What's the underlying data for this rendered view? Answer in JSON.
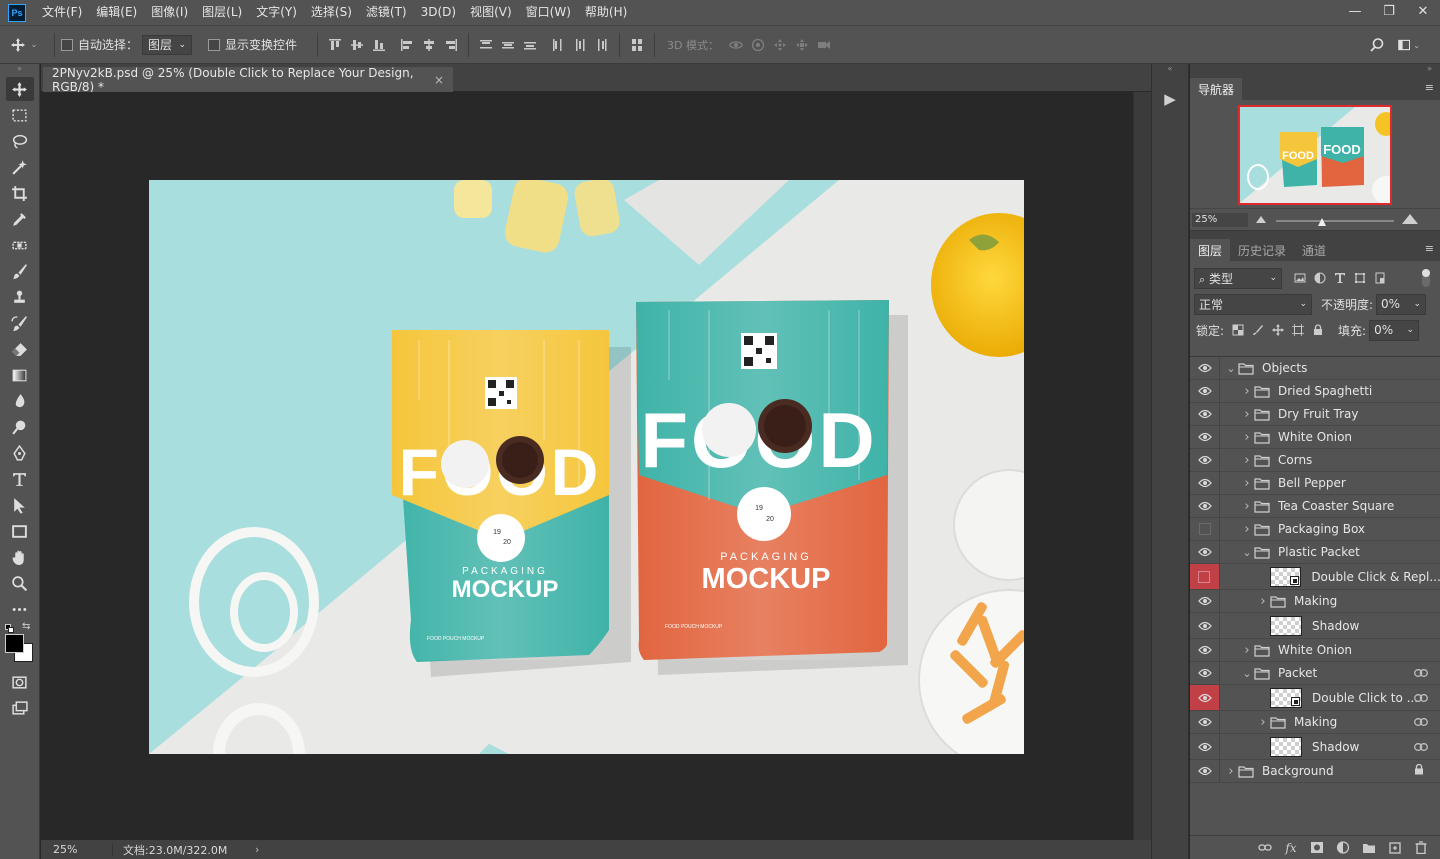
{
  "app": {
    "logo": "Ps"
  },
  "menu": [
    "文件(F)",
    "编辑(E)",
    "图像(I)",
    "图层(L)",
    "文字(Y)",
    "选择(S)",
    "滤镜(T)",
    "3D(D)",
    "视图(V)",
    "窗口(W)",
    "帮助(H)"
  ],
  "window_controls": {
    "minimize": "—",
    "restore": "❐",
    "close": "✕"
  },
  "options": {
    "auto_select_label": "自动选择：",
    "auto_select_value": "图层",
    "show_transform_label": "显示变换控件",
    "mode3d_label": "3D 模式："
  },
  "document": {
    "tab_title": "2PNyv2kB.psd @ 25% (Double Click to Replace Your Design, RGB/8) *",
    "close": "×"
  },
  "status": {
    "zoom": "25%",
    "doc_info": "文档:23.0M/322.0M",
    "arrow": "›"
  },
  "artwork": {
    "yellow_bag": {
      "word": "FOOD",
      "sub": "PACKAGING",
      "title": "MOCKUP",
      "badge_top": "19",
      "badge_bottom": "20",
      "footer": "FOOD POUCH MOCKUP"
    },
    "orange_bag": {
      "word": "FOOD",
      "sub": "PACKAGING",
      "title": "MOCKUP",
      "badge_top": "19",
      "badge_bottom": "20",
      "footer": "FOOD POUCH MOCKUP"
    }
  },
  "colors": {
    "mint": "#a8dedd",
    "paper": "#e9e9e8",
    "yellow": "#f5c63c",
    "teal": "#3fb3a8",
    "orange": "#e2653f",
    "selection_red": "#c04046"
  },
  "navigator": {
    "tab": "导航器",
    "zoom": "25%"
  },
  "layers_panel": {
    "tabs": [
      "图层",
      "历史记录",
      "通道"
    ],
    "filter_kind": "类型",
    "blend_mode": "正常",
    "opacity_label": "不透明度:",
    "opacity_value": "0%",
    "lock_label": "锁定:",
    "fill_label": "填充:",
    "fill_value": "0%",
    "layers": [
      {
        "name": "Objects",
        "type": "group",
        "indent": 0,
        "open": true
      },
      {
        "name": "Dried Spaghetti",
        "type": "group",
        "indent": 1
      },
      {
        "name": "Dry Fruit Tray",
        "type": "group",
        "indent": 1
      },
      {
        "name": "White Onion",
        "type": "group",
        "indent": 1
      },
      {
        "name": "Corns",
        "type": "group",
        "indent": 1
      },
      {
        "name": "Bell Pepper",
        "type": "group",
        "indent": 1
      },
      {
        "name": "Tea Coaster Square",
        "type": "group",
        "indent": 1
      },
      {
        "name": "Packaging Box",
        "type": "group",
        "indent": 1,
        "hidden": true
      },
      {
        "name": "Plastic Packet",
        "type": "group",
        "indent": 1,
        "open": true
      },
      {
        "name": "Double Click & Repl...",
        "type": "smart",
        "indent": 2,
        "hidden": true,
        "red": true
      },
      {
        "name": "Making",
        "type": "group",
        "indent": 2
      },
      {
        "name": "Shadow",
        "type": "pixel",
        "indent": 2
      },
      {
        "name": "White Onion",
        "type": "group",
        "indent": 1
      },
      {
        "name": "Packet",
        "type": "group",
        "indent": 1,
        "open": true,
        "linked": true
      },
      {
        "name": "Double Click to ...",
        "type": "smart",
        "indent": 2,
        "red": true,
        "selected": true,
        "linked": true
      },
      {
        "name": "Making",
        "type": "group",
        "indent": 2,
        "linked": true
      },
      {
        "name": "Shadow",
        "type": "pixel",
        "indent": 2,
        "linked": true
      },
      {
        "name": "Background",
        "type": "group",
        "indent": 0,
        "locked": true
      }
    ],
    "footer_icons": [
      "link-icon",
      "fx-icon",
      "mask-icon",
      "adjustment-icon",
      "new-group-icon",
      "new-layer-icon",
      "trash-icon"
    ],
    "fx_label": "fx"
  }
}
